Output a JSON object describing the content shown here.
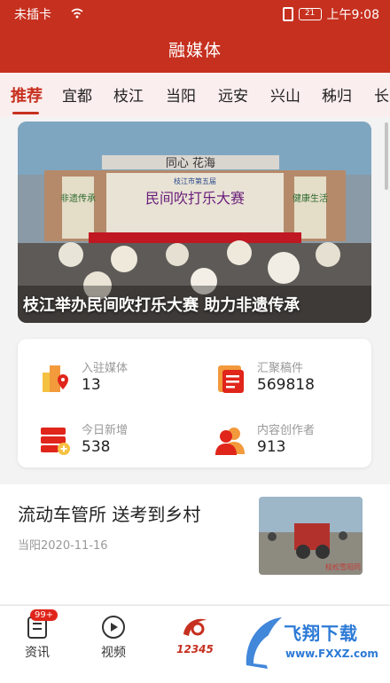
{
  "status_bar": {
    "carrier": "未插卡",
    "battery": "21",
    "time": "上午9:08"
  },
  "header": {
    "title": "融媒体"
  },
  "tabs": [
    {
      "label": "推荐"
    },
    {
      "label": "宜都"
    },
    {
      "label": "枝江"
    },
    {
      "label": "当阳"
    },
    {
      "label": "远安"
    },
    {
      "label": "兴山"
    },
    {
      "label": "秭归"
    },
    {
      "label": "长"
    }
  ],
  "banner": {
    "caption": "枝江举办民间吹打乐大赛 助力非遗传承",
    "stage_sign": "同心 花海",
    "stage_banner": "民间吹打乐大赛",
    "stage_subtitle": "枝江市第五届",
    "stage_left_text": "非遗传承",
    "stage_right_text": "健康生活"
  },
  "stats": [
    {
      "label": "入驻媒体",
      "value": "13",
      "icon": "building-location-icon"
    },
    {
      "label": "汇聚稿件",
      "value": "569818",
      "icon": "document-list-icon"
    },
    {
      "label": "今日新增",
      "value": "538",
      "icon": "add-list-icon"
    },
    {
      "label": "内容创作者",
      "value": "913",
      "icon": "users-icon"
    }
  ],
  "news": {
    "title": "流动车管所 送考到乡村",
    "meta": "当阳2020-11-16",
    "thumb_caption": "枝松雪阳同"
  },
  "bottom_nav": {
    "items": [
      {
        "label": "资讯",
        "badge": "99+",
        "icon": "news-icon"
      },
      {
        "label": "视频",
        "icon": "play-icon"
      },
      {
        "label": "12345",
        "icon": "hotline-logo-icon"
      }
    ]
  },
  "watermark": {
    "text": "飞翔下载",
    "url": "www.FXXZ.com"
  },
  "colors": {
    "brand_red": "#c6301f",
    "tab_bg": "#fbeeee",
    "icon_orange": "#f29a3c",
    "icon_red": "#e0251b"
  }
}
